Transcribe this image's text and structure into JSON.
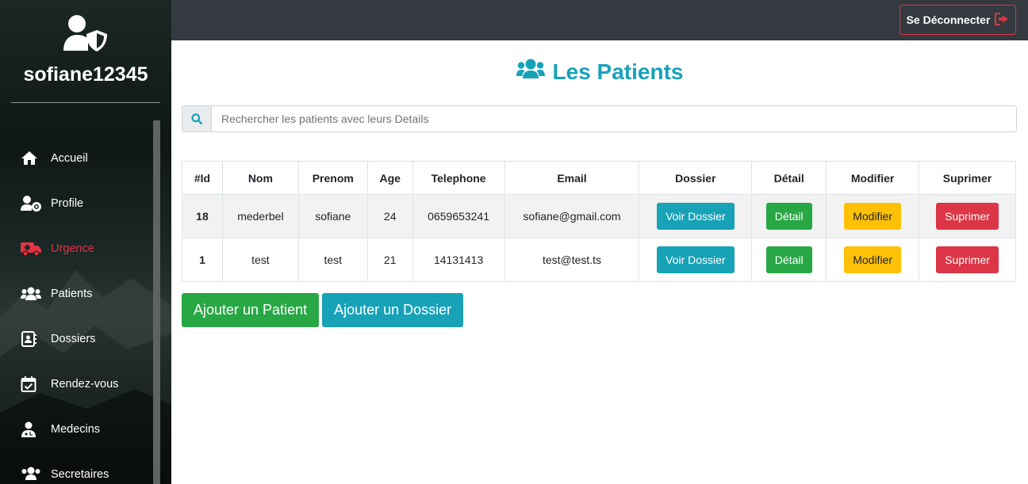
{
  "sidebar": {
    "username": "sofiane12345",
    "items": [
      {
        "label": "Accueil",
        "icon": "home-icon"
      },
      {
        "label": "Profile",
        "icon": "user-cog-icon"
      },
      {
        "label": "Urgence",
        "icon": "ambulance-icon",
        "active": true
      },
      {
        "label": "Patients",
        "icon": "users-icon"
      },
      {
        "label": "Dossiers",
        "icon": "address-book-icon"
      },
      {
        "label": "Rendez-vous",
        "icon": "calendar-check-icon"
      },
      {
        "label": "Medecins",
        "icon": "user-md-icon"
      },
      {
        "label": "Secretaires",
        "icon": "users-cog-icon"
      }
    ]
  },
  "topbar": {
    "logout_label": "Se Déconnecter"
  },
  "main": {
    "title": "Les Patients",
    "search_placeholder": "Rechercher les patients avec leurs Details",
    "table": {
      "headers": [
        "#Id",
        "Nom",
        "Prenom",
        "Age",
        "Telephone",
        "Email",
        "Dossier",
        "Détail",
        "Modifier",
        "Suprimer"
      ],
      "rows": [
        {
          "id": "18",
          "nom": "mederbel",
          "prenom": "sofiane",
          "age": "24",
          "telephone": "0659653241",
          "email": "sofiane@gmail.com"
        },
        {
          "id": "1",
          "nom": "test",
          "prenom": "test",
          "age": "21",
          "telephone": "14131413",
          "email": "test@test.ts"
        }
      ],
      "buttons": {
        "dossier": "Voir Dossier",
        "detail": "Détail",
        "modifier": "Modifier",
        "suprimer": "Suprimer"
      }
    },
    "add_patient_label": "Ajouter un Patient",
    "add_dossier_label": "Ajouter un Dossier"
  },
  "colors": {
    "accent": "#17a2b8",
    "success": "#28a745",
    "warning": "#ffc107",
    "danger": "#dc3545",
    "topbar": "#343a40"
  }
}
